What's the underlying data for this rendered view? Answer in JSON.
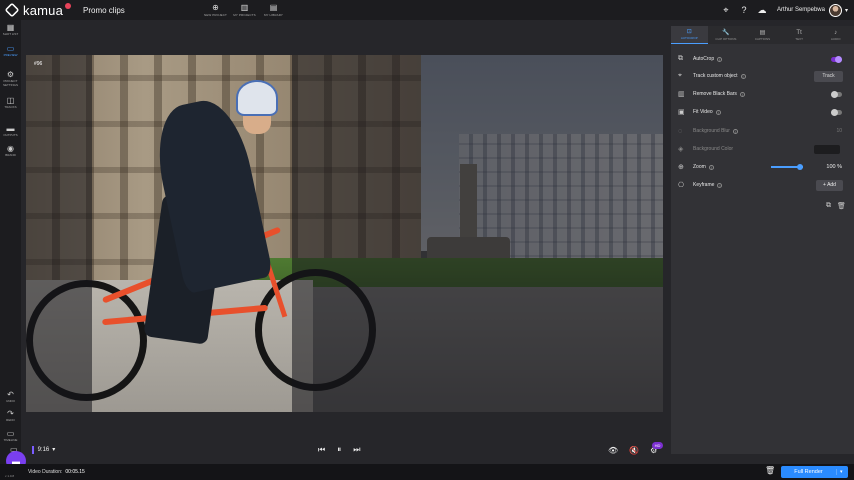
{
  "app": {
    "brand": "kamua",
    "project_title": "Promo clips"
  },
  "top_actions": [
    {
      "icon": "plus-circle-icon",
      "glyph": "⊕",
      "label": "NEW PROJECT"
    },
    {
      "icon": "projects-icon",
      "glyph": "▥",
      "label": "MY PROJECTS"
    },
    {
      "icon": "library-icon",
      "glyph": "▤",
      "label": "MY LIBRARY"
    }
  ],
  "user": {
    "name": "Arthur Sempebwa"
  },
  "sidebar": {
    "items": [
      {
        "icon": "grid-icon",
        "glyph": "▦",
        "label": "SHOT LIST"
      },
      {
        "icon": "monitor-icon",
        "glyph": "▭",
        "label": "PREVIEW"
      },
      {
        "icon": "gear-icon",
        "glyph": "⚙",
        "label": "PROJECT SETTINGS"
      },
      {
        "icon": "layers-icon",
        "glyph": "◫",
        "label": "TRACKS"
      },
      {
        "icon": "export-icon",
        "glyph": "▬",
        "label": "OUTPUTS"
      },
      {
        "icon": "brand-icon",
        "glyph": "◉",
        "label": "BRAND"
      }
    ],
    "bottom_items": [
      {
        "icon": "undo-icon",
        "glyph": "↶",
        "label": "UNDO"
      },
      {
        "icon": "redo-icon",
        "glyph": "↷",
        "label": "REDO"
      },
      {
        "icon": "timeline-icon",
        "glyph": "▭",
        "label": "TIMELINE"
      }
    ]
  },
  "stage": {
    "label": "#96"
  },
  "player": {
    "aspect_ratio": "9:16",
    "aspect_caret": "▾",
    "controls": {
      "prev": "⏮",
      "pause": "⏸",
      "next": "⏭"
    },
    "right_controls": {
      "eye": "👁",
      "mute": "🔇",
      "settings": "⚙"
    },
    "badge": "HD"
  },
  "footer": {
    "duration_label": "Video Duration:",
    "duration_value": "00:05.15",
    "version": "v 1.0.8",
    "render_button": "Full Render",
    "render_caret": "▾"
  },
  "panel": {
    "tabs": [
      {
        "icon": "crop-icon",
        "glyph": "⊡",
        "label": "AUTOCROP"
      },
      {
        "icon": "wrench-icon",
        "glyph": "🔧",
        "label": "CLIP OPTIONS"
      },
      {
        "icon": "captions-icon",
        "glyph": "▤",
        "label": "CAPTIONS"
      },
      {
        "icon": "text-icon",
        "glyph": "Tt",
        "label": "TEXT"
      },
      {
        "icon": "audio-icon",
        "glyph": "♪",
        "label": "AUDIO"
      }
    ],
    "rows": [
      {
        "icon": "autocrop-icon",
        "glyph": "⧉",
        "label": "AutoCrop",
        "control": "toggle-on"
      },
      {
        "icon": "track-object-icon",
        "glyph": "⌖",
        "label": "Track custom object",
        "control": "button",
        "button_label": "Track"
      },
      {
        "icon": "black-bars-icon",
        "glyph": "▥",
        "label": "Remove Black Bars",
        "control": "toggle-off"
      },
      {
        "icon": "fit-video-icon",
        "glyph": "▣",
        "label": "Fit Video",
        "control": "toggle-off"
      },
      {
        "icon": "blur-icon",
        "glyph": "◌",
        "label": "Background Blur",
        "control": "number",
        "value": "10",
        "disabled": true
      },
      {
        "icon": "paint-icon",
        "glyph": "◈",
        "label": "Background Color",
        "control": "swatch",
        "disabled": true,
        "swatch_color": "#1d1d1f"
      },
      {
        "icon": "zoom-icon",
        "glyph": "⊕",
        "label": "Zoom",
        "control": "slider",
        "value": "100",
        "unit": "%"
      },
      {
        "icon": "keyframe-icon",
        "glyph": "⎔",
        "label": "Keyframe",
        "control": "add",
        "button_label": "Add"
      }
    ],
    "zoom_level": 1.0
  },
  "colors": {
    "accent": "#4a9eff",
    "purple": "#7b2fd0",
    "render": "#2a8bff"
  }
}
